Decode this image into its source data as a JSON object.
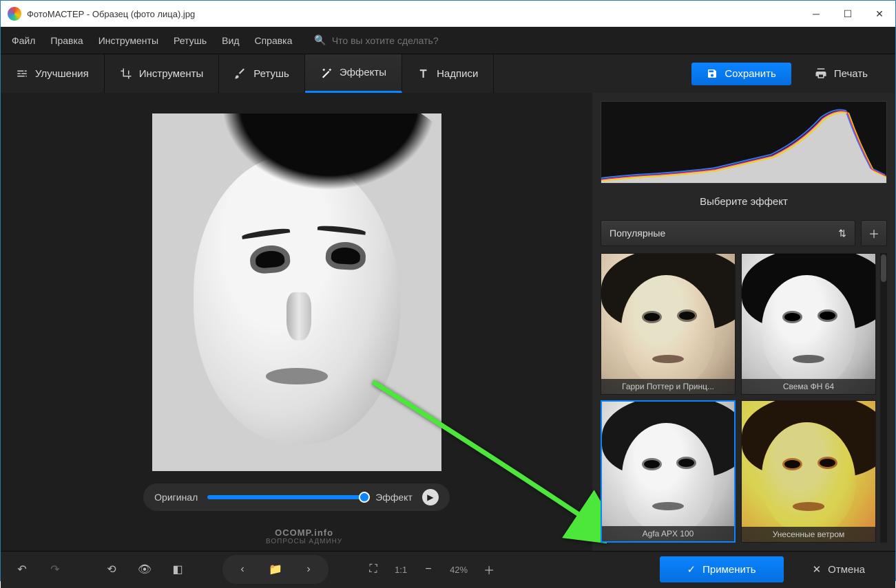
{
  "window": {
    "title": "ФотоМАСТЕР - Образец (фото лица).jpg"
  },
  "menu": {
    "file": "Файл",
    "edit": "Правка",
    "tools": "Инструменты",
    "retouch": "Ретушь",
    "view": "Вид",
    "help": "Справка",
    "search_placeholder": "Что вы хотите сделать?"
  },
  "tabs": {
    "enhance": "Улучшения",
    "tools": "Инструменты",
    "retouch": "Ретушь",
    "effects": "Эффекты",
    "captions": "Надписи"
  },
  "actions": {
    "save": "Сохранить",
    "print": "Печать"
  },
  "compare": {
    "original": "Оригинал",
    "effect": "Эффект"
  },
  "panel": {
    "title": "Выберите эффект",
    "category": "Популярные",
    "effects": [
      {
        "label": "Гарри Поттер и Принц..."
      },
      {
        "label": "Свема ФН 64"
      },
      {
        "label": "Agfa APX 100"
      },
      {
        "label": "Унесенные ветром"
      }
    ]
  },
  "bottom": {
    "apply": "Применить",
    "cancel": "Отмена",
    "zoom": "1:1",
    "zoom_pct": "42%"
  },
  "watermark": {
    "line1": "OCOMP.info",
    "line2": "ВОПРОСЫ АДМИНУ"
  }
}
